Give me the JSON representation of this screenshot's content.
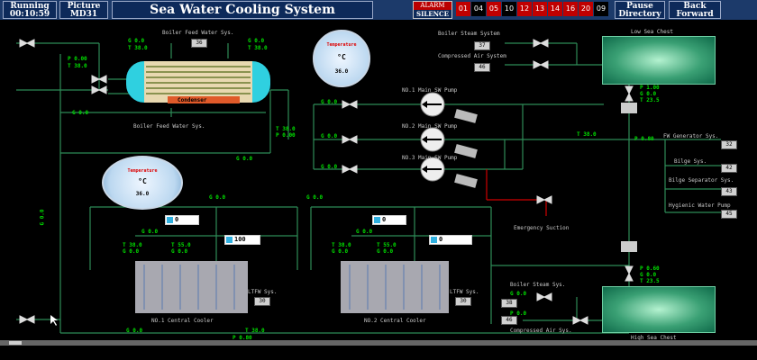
{
  "header": {
    "running_label": "Running",
    "running_time": "00:10:59",
    "picture_label": "Picture",
    "picture_id": "MD31",
    "title": "Sea Water Cooling System",
    "alarm_label": "ALARM",
    "silence_label": "SILENCE",
    "alarm_numbers": [
      "01",
      "04",
      "05",
      "10",
      "12",
      "13",
      "14",
      "16",
      "20",
      "09"
    ],
    "alarm_active": [
      true,
      false,
      true,
      false,
      true,
      true,
      true,
      true,
      true,
      false
    ],
    "pause_label": "Pause",
    "directory_label": "Directory",
    "back_label": "Back",
    "forward_label": "Forward"
  },
  "condenser": {
    "label": "Condenser",
    "feed_in_label": "Boiler Feed Water Sys.",
    "feed_out_label": "Boiler Feed Water Sys.",
    "g_in": "G 0.0",
    "t_in": "T 38.0",
    "box_in": "36",
    "g_out": "G 0.0",
    "t_out": "T 38.0",
    "p_left": "P 0.00",
    "t_left": "T 38.0"
  },
  "gauge_top": {
    "title": "Temperature",
    "unit": "°C",
    "value": "36.0"
  },
  "gauge_left": {
    "title": "Temperature",
    "unit": "°C",
    "value": "36.0"
  },
  "pumps": [
    {
      "label": "NO.1 Main SW Pump",
      "g": "G 0.0"
    },
    {
      "label": "NO.2 Main SW Pump",
      "g": "G 0.0"
    },
    {
      "label": "NO.3 Main SW Pump",
      "g": "G 0.0"
    }
  ],
  "low_chest": {
    "label": "Low Sea Chest",
    "p": "P 1.00",
    "g": "G 0.0",
    "t": "T 23.5",
    "steam_label": "Boiler Steam System",
    "steam_box": "37",
    "air_label": "Compressed Air System",
    "air_box": "46"
  },
  "high_chest": {
    "label": "High Sea Chest",
    "p": "P 0.60",
    "g": "G 0.0",
    "t": "T 23.5",
    "steam_label": "Boiler Steam Sys.",
    "air_label": "Compressed Air Sys.",
    "g_steam": "G 0.0",
    "p_air": "P 0.0",
    "steam_box": "38",
    "air_box": "46"
  },
  "right_consumers": [
    {
      "label": "FW Generator Sys.",
      "box": "32"
    },
    {
      "label": "Bilge Sys.",
      "box": "42"
    },
    {
      "label": "Bilge Separator Sys.",
      "box": "43"
    },
    {
      "label": "Hygienic Water Pump",
      "box": "45"
    }
  ],
  "main_line": {
    "t": "T 38.0",
    "p": "P 0.00",
    "t_right": "T 38.0",
    "p_right": "P 0.80",
    "g_mid1": "G 0.0",
    "g_mid2": "G 0.0",
    "g_left": "G 0.0",
    "g_far_left": "G 0.0",
    "g_mid3": "G 0.0"
  },
  "emergency_label": "Emergency Suction",
  "coolers": [
    {
      "label": "NO.1 Central Cooler",
      "g_in": "G 0.0",
      "t_in": "T 38.0",
      "t_in2": "T 55.0",
      "g_left": "G 0.0",
      "t_left": "T 38.0",
      "g_left2": "G 0.0",
      "valve1": "0",
      "valve2": "100",
      "ltfw_label": "LTFW Sys.",
      "ltfw_box": "30"
    },
    {
      "label": "NO.2 Central Cooler",
      "g_in": "G 0.0",
      "t_in": "T 38.0",
      "t_in2": "T 55.0",
      "g_left": "G 0.0",
      "t_left": "T 38.0",
      "g_left2": "G 0.0",
      "valve1": "0",
      "valve2": "0",
      "ltfw_label": "LTFW Sys.",
      "ltfw_box": "30"
    }
  ],
  "bottom": {
    "g": "G 0.0",
    "t": "T 38.0",
    "p": "P 0.80"
  },
  "colors": {
    "pipe_green": "#2e8b57",
    "value_green": "#00e000",
    "header_blue": "#0d2a5a",
    "alarm_red": "#c00000"
  },
  "icons": [
    "gate-valve-icon",
    "pump-arrow-icon",
    "motor-icon",
    "check-valve-icon",
    "temperature-gauge-icon",
    "cursor-arrow-icon"
  ]
}
